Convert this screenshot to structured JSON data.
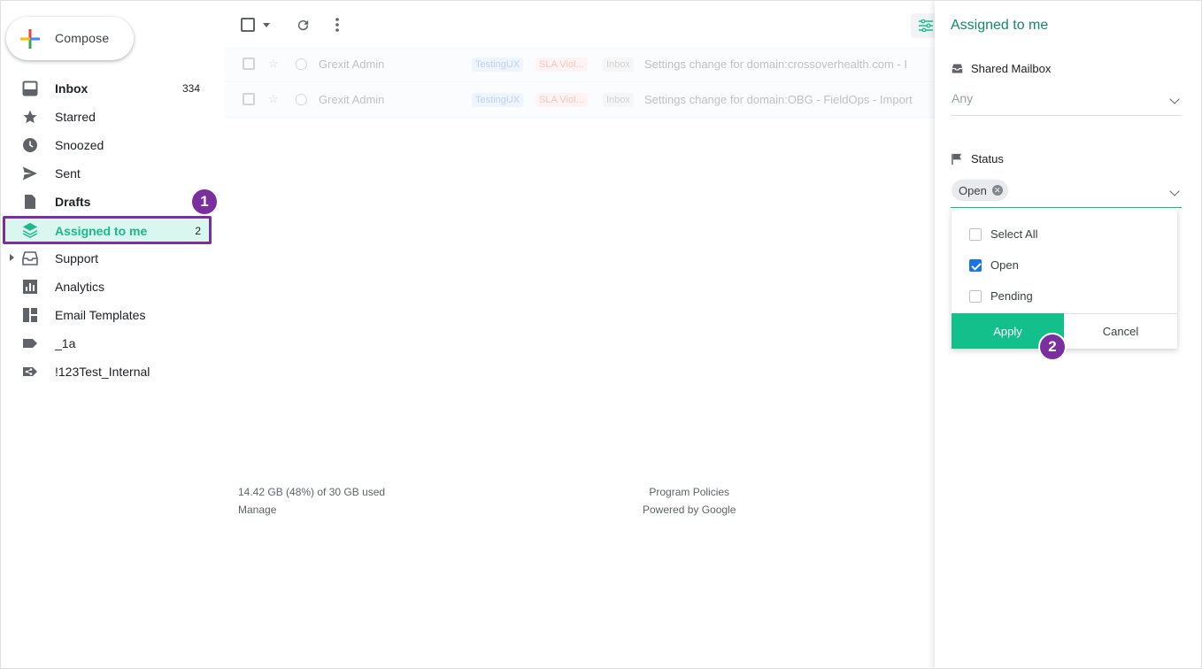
{
  "compose": {
    "label": "Compose"
  },
  "sidebar": {
    "items": [
      {
        "label": "Inbox",
        "count": "334",
        "icon": "inbox-icon"
      },
      {
        "label": "Starred",
        "count": "",
        "icon": "star-icon"
      },
      {
        "label": "Snoozed",
        "count": "",
        "icon": "clock-icon"
      },
      {
        "label": "Sent",
        "count": "",
        "icon": "send-icon"
      },
      {
        "label": "Drafts",
        "count": "",
        "icon": "draft-icon"
      },
      {
        "label": "Assigned to me",
        "count": "2",
        "icon": "layers-icon"
      },
      {
        "label": "Support",
        "count": "",
        "icon": "shared-inbox-icon"
      },
      {
        "label": "Analytics",
        "count": "",
        "icon": "analytics-icon"
      },
      {
        "label": "Email Templates",
        "count": "",
        "icon": "templates-icon"
      },
      {
        "label": "_1a",
        "count": "",
        "icon": "label-icon"
      },
      {
        "label": "!123Test_Internal",
        "count": "",
        "icon": "shared-label-icon"
      }
    ]
  },
  "steps": {
    "one": "1",
    "two": "2"
  },
  "emails": [
    {
      "sender": "Grexit Admin",
      "tags": [
        "TestingUX",
        "SLA Viol...",
        "Inbox"
      ],
      "subject": "Settings change for domain:crossoverhealth.com - I"
    },
    {
      "sender": "Grexit Admin",
      "tags": [
        "TestingUX",
        "SLA Viol...",
        "Inbox"
      ],
      "subject": "Settings change for domain:OBG - FieldOps - Import"
    }
  ],
  "footer": {
    "storage": "14.42 GB (48%) of 30 GB used",
    "manage": "Manage",
    "policies": "Program Policies",
    "powered": "Powered by Google"
  },
  "panel": {
    "title": "Assigned to me",
    "shared_mailbox_label": "Shared Mailbox",
    "shared_mailbox_placeholder": "Any",
    "status_label": "Status",
    "status_chip": "Open",
    "options": [
      {
        "label": "Select All",
        "checked": false
      },
      {
        "label": "Open",
        "checked": true
      },
      {
        "label": "Pending",
        "checked": false
      }
    ],
    "apply_label": "Apply",
    "cancel_label": "Cancel"
  },
  "colors": {
    "accent": "#13c08c",
    "step": "#7b2f9e",
    "active_bg": "#d9f7ee"
  }
}
